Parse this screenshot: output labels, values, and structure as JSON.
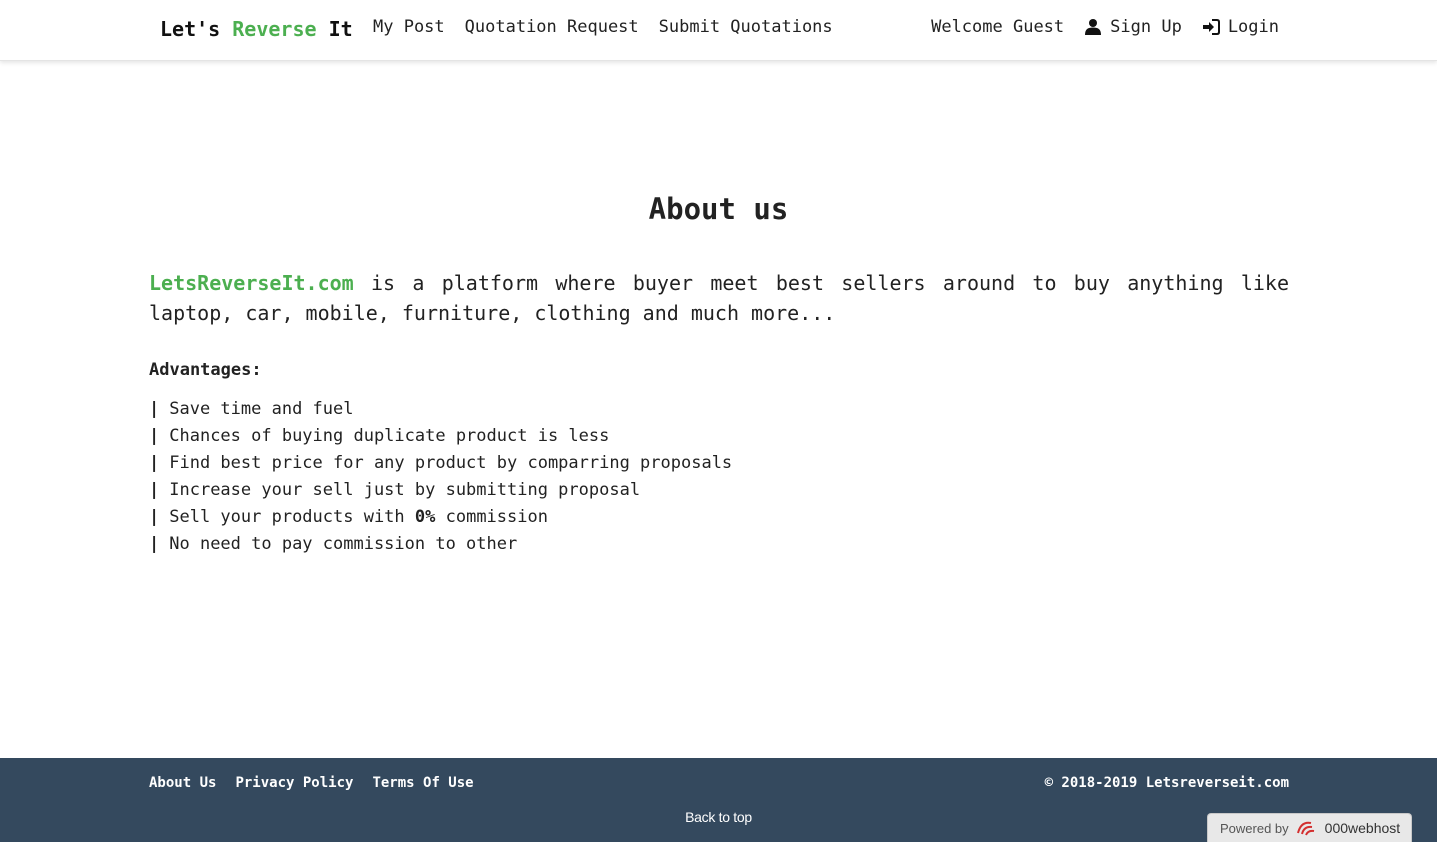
{
  "navbar": {
    "brand_part1": "Let's ",
    "brand_part2": "Reverse",
    "brand_part3": " It",
    "links": [
      "My Post",
      "Quotation Request",
      "Submit Quotations"
    ],
    "welcome": "Welcome Guest",
    "signup_label": "Sign Up",
    "login_label": "Login",
    "signup_icon": "user-icon",
    "login_icon": "sign-in-icon"
  },
  "main": {
    "title": "About us",
    "site_name": "LetsReverseIt.com",
    "intro_text": " is a platform where buyer meet best sellers around to buy anything like laptop, car, mobile, furniture, clothing and much more...",
    "advantages_title": "Advantages:",
    "bullet": "|",
    "advantages": [
      "Save time and fuel",
      "Chances of buying duplicate product is less",
      "Find best price for any product by comparring proposals",
      "Increase your sell just by submitting proposal"
    ],
    "adv5_prefix": "Sell your products with ",
    "adv5_bold": "0%",
    "adv5_suffix": " commission",
    "adv6": "No need to pay commission to other"
  },
  "footer": {
    "links": [
      "About Us",
      "Privacy Policy",
      "Terms Of Use"
    ],
    "copyright": "© 2018-2019 Letsreverseit.com",
    "back_to_top": "Back to top",
    "powered_by": "Powered by",
    "host": "000webhost"
  },
  "colors": {
    "accent_green": "#4caf50",
    "footer_bg": "#34495e"
  }
}
